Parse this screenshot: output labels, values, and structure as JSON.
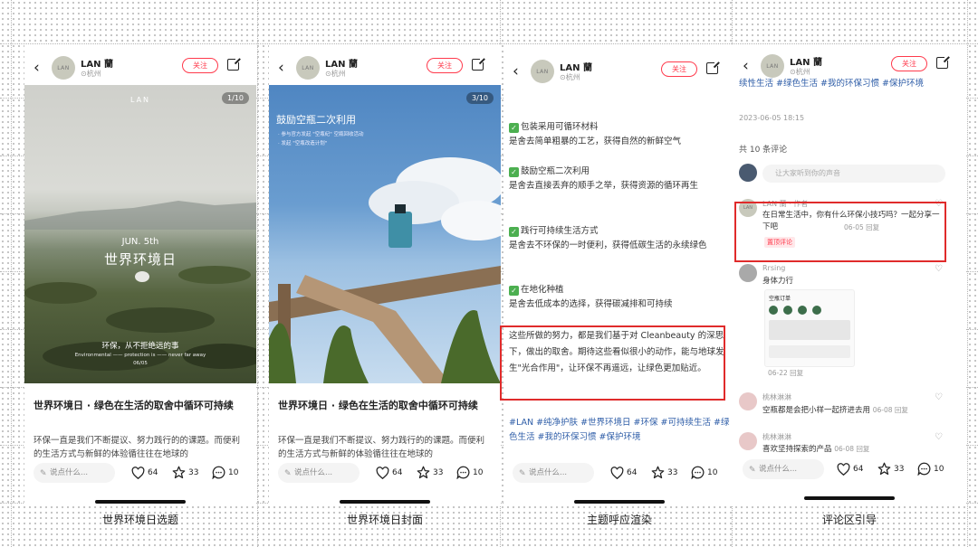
{
  "user": {
    "name": "LAN 蘭",
    "location": "杭州",
    "avatar_text": "LAN",
    "follow_label": "关注"
  },
  "post": {
    "title": "世界环境日 · 绿色在生活的取舍中循环可持续",
    "desc": "环保一直是我们不断提议、努力践行的的课题。而便利的生活方式与新鲜的体验循往往在地球的"
  },
  "toolbar": {
    "comment_placeholder": "说点什么...",
    "likes": "64",
    "stars": "33",
    "comments": "10"
  },
  "screen1": {
    "badge": "1/10",
    "brand": "LAN",
    "date_text": "JUN. 5th",
    "big_title": "世界环境日",
    "slogan": "环保，从不拒绝远的事",
    "sub_en": "Environmental —— protection is —— never far away",
    "date_small": "06/05",
    "caption": "世界环境日选题"
  },
  "screen2": {
    "badge": "3/10",
    "title": "鼓励空瓶二次利用",
    "sub1": "· 参与官方发起 \"空瓶纪\" 空瓶回收活动",
    "sub2": "· 发起 \"空瓶改造计划\"",
    "caption": "世界环境日封面"
  },
  "screen3": {
    "items": [
      {
        "head": "包装采用可循环材料",
        "body": "是舍去简单粗暴的工艺，获得自然的新鲜空气"
      },
      {
        "head": "鼓励空瓶二次利用",
        "body": "是舍去直接丢弃的顺手之举，获得资源的循环再生"
      },
      {
        "head": "践行可持续生活方式",
        "body": "是舍去不环保的一时便利，获得低碳生活的永续绿色"
      },
      {
        "head": "在地化种植",
        "body": "是舍去低成本的选择，获得碳减排和可持续"
      }
    ],
    "highlight": "这些所做的努力，都是我们基于对 Cleanbeauty 的深思下，做出的取舍。期待这些看似很小的动作，能与地球发生\"光合作用\"，让环保不再遥远，让绿色更加贴近。",
    "tags": "#LAN #纯净护肤 #世界环境日 #环保 #可持续生活 #绿色生活 #我的环保习惯 #保护环境",
    "caption": "主题呼应渲染"
  },
  "screen4": {
    "tags_top": "续性生活 #绿色生活 #我的环保习惯 #保护环境",
    "datetime": "2023-06-05 18:15",
    "count": "共 10 条评论",
    "input_placeholder": "让大家听到你的声音",
    "c1_name": "LAN 蘭 · 作者",
    "c1_text": "在日常生活中，你有什么环保小技巧吗？一起分享一下吧",
    "c1_time": "06-05 回复",
    "c1_tag": "置顶评论",
    "c2_name": "Rrsing",
    "c2_text": "身体力行",
    "c2_img_title": "空瓶订单",
    "c2_time": "06-22 回复",
    "c3_name": "桃林淋淋",
    "c3_text": "空瓶都是会把小样一起挤进去用",
    "c3_time": "06-08 回复",
    "c4_name": "桃林淋淋",
    "c4_text": "喜欢坚持探索的产品",
    "c4_time": "06-08 回复",
    "caption": "评论区引导"
  },
  "colors": {
    "accent": "#ff3a4c",
    "highlight_box": "#e02b2b",
    "tag_blue": "#2f5ea8",
    "check_green": "#4caf50"
  }
}
